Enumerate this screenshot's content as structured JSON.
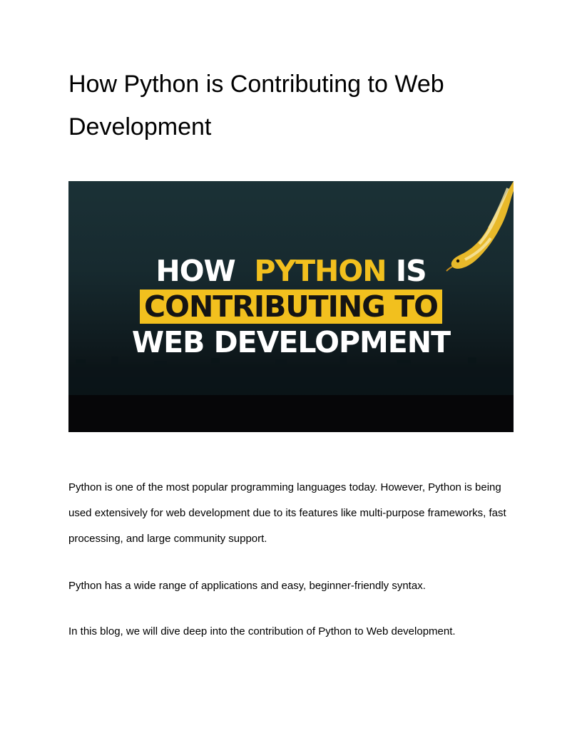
{
  "document": {
    "title": "How Python is Contributing to Web Development",
    "hero_image": {
      "line1_white_a": "HOW",
      "line1_yellow": "PYTHON",
      "line1_white_b": "IS",
      "line2_highlight": "CONTRIBUTING TO",
      "line3_white": "WEB DEVELOPMENT",
      "colors": {
        "background_top": "#1b3136",
        "background_bottom": "#050708",
        "accent_yellow": "#f2c01e",
        "text_white": "#ffffff"
      },
      "icon": "python-snake-icon"
    },
    "paragraphs": [
      "Python is one of the most popular programming languages today. However, Python is being used extensively for web development due to its features like multi-purpose frameworks, fast processing, and large community support.",
      "Python has a wide range of applications and easy, beginner-friendly syntax.",
      "In this blog, we will dive deep into the contribution of Python to Web development."
    ]
  }
}
